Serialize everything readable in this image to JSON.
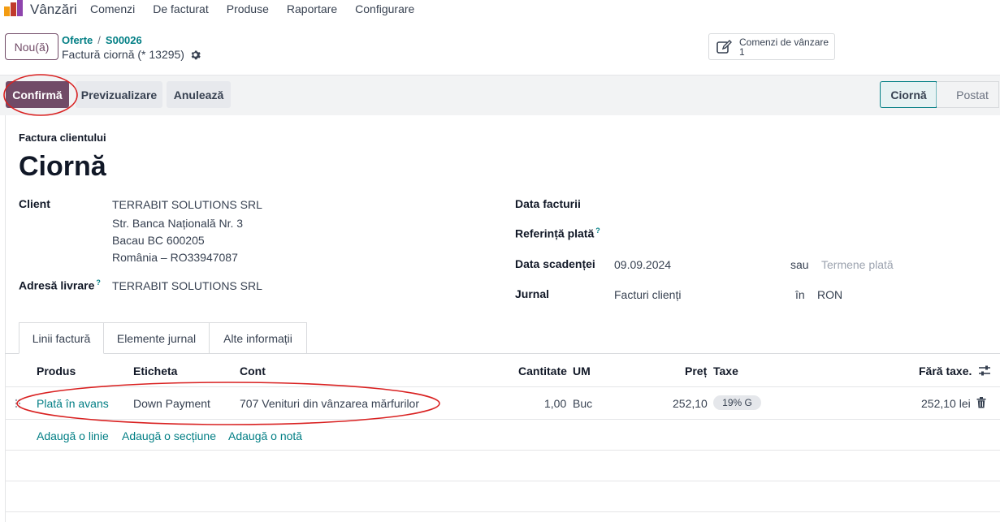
{
  "navbar": {
    "app_name": "Vânzări",
    "menu": [
      "Comenzi",
      "De facturat",
      "Produse",
      "Raportare",
      "Configurare"
    ]
  },
  "control_panel": {
    "new_label": "Nou(ă)",
    "breadcrumb": [
      "Oferte",
      "S00026"
    ],
    "record_title": "Factură ciornă (* 13295)",
    "smart_button": {
      "label": "Comenzi de vânzare",
      "count": "1"
    }
  },
  "statusbar": {
    "confirm_label": "Confirmă",
    "preview_label": "Previzualizare",
    "cancel_label": "Anulează",
    "stages": [
      "Ciornă",
      "Postat"
    ],
    "active_stage": "Ciornă"
  },
  "form": {
    "doc_type": "Factura clientului",
    "state": "Ciornă",
    "client_label": "Client",
    "client_lines": [
      "TERRABIT SOLUTIONS SRL",
      "Str. Banca Națională Nr. 3",
      "Bacau BC 600205",
      "România – RO33947087"
    ],
    "delivery_label": "Adresă livrare",
    "delivery_value": "TERRABIT SOLUTIONS SRL",
    "invoice_date_label": "Data facturii",
    "payment_ref_label": "Referință plată",
    "due_date_label": "Data scadenței",
    "due_date_value": "09.09.2024",
    "or_label": "sau",
    "terms_placeholder": "Termene plată",
    "journal_label": "Jurnal",
    "journal_value": "Facturi clienți",
    "in_label": "în",
    "currency": "RON",
    "help_mark": "?"
  },
  "tabs": [
    "Linii factură",
    "Elemente jurnal",
    "Alte informații"
  ],
  "table": {
    "headers": {
      "product": "Produs",
      "label": "Eticheta",
      "account": "Cont",
      "qty": "Cantitate",
      "uom": "UM",
      "price": "Preț",
      "taxes": "Taxe",
      "subtotal": "Fără taxe."
    },
    "rows": [
      {
        "product": "Plată în avans",
        "label": "Down Payment",
        "account": "707 Venituri din vânzarea mărfurilor",
        "qty": "1,00",
        "uom": "Buc",
        "price": "252,10",
        "tax": "19% G",
        "subtotal": "252,10 lei"
      }
    ],
    "add_line": "Adaugă o linie",
    "add_section": "Adaugă o secțiune",
    "add_note": "Adaugă o notă"
  },
  "colors": {
    "brand": "#714b67",
    "link": "#017e84",
    "annotation": "#d92121"
  }
}
